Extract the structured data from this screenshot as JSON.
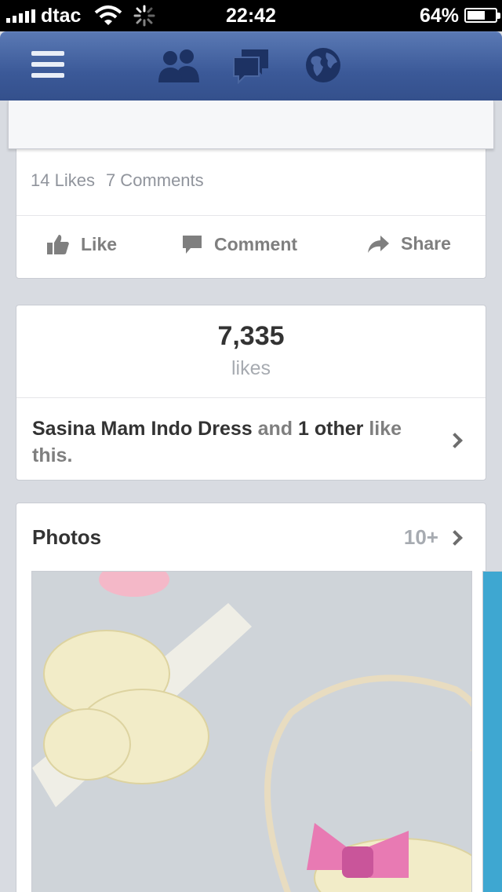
{
  "status_bar": {
    "carrier": "dtac",
    "time": "22:42",
    "battery_percent": "64%",
    "battery_level": 0.64,
    "signal_bars": 5
  },
  "nav": {
    "icons": [
      "menu-icon",
      "friend-requests-icon",
      "messages-icon",
      "notifications-globe-icon"
    ],
    "color": "#3b5998"
  },
  "post": {
    "likes_count": "14 Likes",
    "comments_count": "7 Comments",
    "actions": {
      "like": "Like",
      "comment": "Comment",
      "share": "Share"
    }
  },
  "likes_card": {
    "count": "7,335",
    "label": "likes",
    "friend_name": "Sasina Mam Indo Dress",
    "and": "and",
    "others": "1 other",
    "suffix": "like this."
  },
  "photos": {
    "title": "Photos",
    "count": "10+"
  }
}
